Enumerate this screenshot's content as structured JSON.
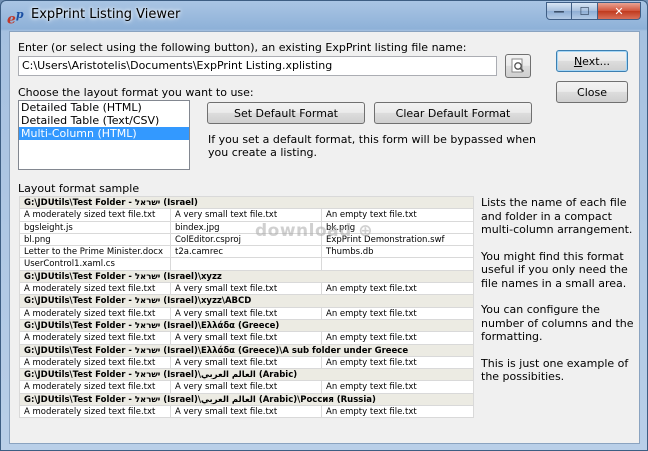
{
  "window": {
    "title": "ExpPrint Listing Viewer",
    "app_icon_text": "e",
    "app_icon_sup": "p"
  },
  "caption_buttons": {
    "minimize": "—",
    "maximize": "☐",
    "close": "✕"
  },
  "file": {
    "label": "Enter (or select using the following button), an existing ExpPrint listing file name:",
    "path": "C:\\Users\\Aristotelis\\Documents\\ExpPrint Listing.xplisting"
  },
  "buttons": {
    "next_prefix": "N",
    "next_rest": "ext...",
    "close": "Close",
    "set_default": "Set Default Format",
    "clear_default": "Clear Default Format"
  },
  "format": {
    "label": "Choose the layout format you want to use:",
    "items": [
      "Detailed Table (HTML)",
      "Detailed Table (Text/CSV)",
      "Multi-Column (HTML)"
    ],
    "selected_index": 2,
    "default_note": "If you set a default format, this form will be bypassed when you create a listing."
  },
  "sample": {
    "label": "Layout format sample",
    "watermark": "download ⊕",
    "rows": [
      {
        "type": "header",
        "text": "G:\\JDUtils\\Test Folder - ישראל (Israel)"
      },
      {
        "type": "cells",
        "cells": [
          "A moderately sized text file.txt",
          "A very small text file.txt",
          "An empty text file.txt"
        ]
      },
      {
        "type": "cells",
        "cells": [
          "bgsleight.js",
          "bindex.jpg",
          "bk.png"
        ]
      },
      {
        "type": "cells",
        "cells": [
          "bl.png",
          "ColEditor.csproj",
          "ExpPrint Demonstration.swf"
        ]
      },
      {
        "type": "cells",
        "cells": [
          "Letter to the Prime Minister.docx",
          "t2a.camrec",
          "Thumbs.db"
        ]
      },
      {
        "type": "cells",
        "cells": [
          "UserControl1.xaml.cs",
          "",
          ""
        ]
      },
      {
        "type": "header",
        "text": "G:\\JDUtils\\Test Folder - ישראל (Israel)\\xyzz"
      },
      {
        "type": "cells",
        "cells": [
          "A moderately sized text file.txt",
          "A very small text file.txt",
          "An empty text file.txt"
        ]
      },
      {
        "type": "header",
        "text": "G:\\JDUtils\\Test Folder - ישראל (Israel)\\xyzz\\ABCD"
      },
      {
        "type": "cells",
        "cells": [
          "A moderately sized text file.txt",
          "A very small text file.txt",
          "An empty text file.txt"
        ]
      },
      {
        "type": "header",
        "text": "G:\\JDUtils\\Test Folder - ישראל (Israel)\\Ελλάδα (Greece)"
      },
      {
        "type": "cells",
        "cells": [
          "A moderately sized text file.txt",
          "A very small text file.txt",
          "An empty text file.txt"
        ]
      },
      {
        "type": "header",
        "text": "G:\\JDUtils\\Test Folder - ישראל (Israel)\\Ελλάδα (Greece)\\A sub folder under Greece"
      },
      {
        "type": "cells",
        "cells": [
          "A moderately sized text file.txt",
          "A very small text file.txt",
          "An empty text file.txt"
        ]
      },
      {
        "type": "header",
        "text": "G:\\JDUtils\\Test Folder - ישראל (Israel)\\العالم العربي (Arabic)"
      },
      {
        "type": "cells",
        "cells": [
          "A moderately sized text file.txt",
          "A very small text file.txt",
          "An empty text file.txt"
        ]
      },
      {
        "type": "header",
        "text": "G:\\JDUtils\\Test Folder - ישראל (Israel)\\العالم العربي (Arabic)\\Россия (Russia)"
      },
      {
        "type": "cells",
        "cells": [
          "A moderately sized text file.txt",
          "A very small text file.txt",
          "An empty text file.txt"
        ]
      }
    ]
  },
  "description": {
    "paragraphs": [
      "Lists the name of each file and folder in a compact multi-column arrangement.",
      "You might find this format useful if you only need the file names in a small area.",
      "You can configure the number of columns and the formatting.",
      "This is just one example of the possibities."
    ]
  }
}
